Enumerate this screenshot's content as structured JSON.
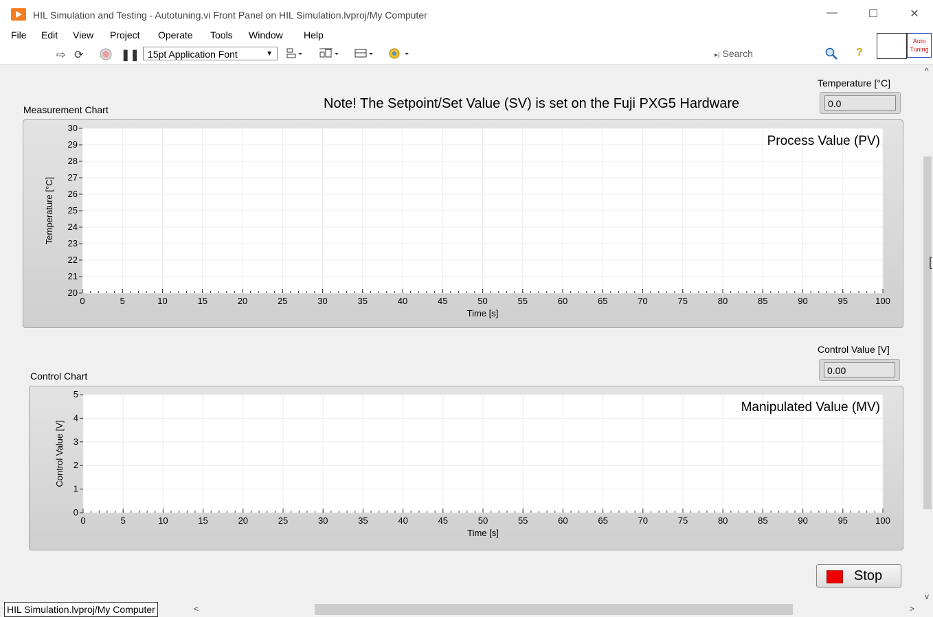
{
  "window": {
    "title": "HIL Simulation and Testing - Autotuning.vi Front Panel on HIL Simulation.lvproj/My Computer",
    "minimize": "—",
    "maximize": "☐",
    "close": "✕"
  },
  "menu": [
    "File",
    "Edit",
    "View",
    "Project",
    "Operate",
    "Tools",
    "Window",
    "Help"
  ],
  "toolbar": {
    "font_select": "15pt Application Font",
    "search_placeholder": "Search",
    "help_glyph": "?"
  },
  "vi_connector": {
    "line1": "Auto",
    "line2": "Tuning"
  },
  "note": "Note! The Setpoint/Set Value (SV) is set on the Fuji PXG5 Hardware",
  "temperature_indicator": {
    "label": "Temperature [°C]",
    "value": "0.0"
  },
  "control_indicator": {
    "label": "Control Value [V]",
    "value": "0.00"
  },
  "measurement_chart": {
    "label": "Measurement Chart",
    "plot_legend": "Process Value (PV)",
    "ylabel": "Temperature [°C]",
    "xlabel": "Time [s]"
  },
  "control_chart": {
    "label": "Control Chart",
    "plot_legend": "Manipulated Value (MV)",
    "ylabel": "Control Value [V]",
    "xlabel": "Time [s]"
  },
  "stop_button": "Stop",
  "status_bar": {
    "project_context": "HIL Simulation.lvproj/My Computer"
  },
  "chart_data": [
    {
      "type": "line",
      "title": "",
      "xlabel": "Time [s]",
      "ylabel": "Temperature [°C]",
      "xlim": [
        0,
        100
      ],
      "ylim": [
        20,
        30
      ],
      "xticks": [
        0,
        5,
        10,
        15,
        20,
        25,
        30,
        35,
        40,
        45,
        50,
        55,
        60,
        65,
        70,
        75,
        80,
        85,
        90,
        95,
        100
      ],
      "yticks": [
        20,
        21,
        22,
        23,
        24,
        25,
        26,
        27,
        28,
        29,
        30
      ],
      "series": [
        {
          "name": "Process Value (PV)",
          "values": []
        }
      ],
      "grid": true
    },
    {
      "type": "line",
      "title": "",
      "xlabel": "Time [s]",
      "ylabel": "Control Value [V]",
      "xlim": [
        0,
        100
      ],
      "ylim": [
        0,
        5
      ],
      "xticks": [
        0,
        5,
        10,
        15,
        20,
        25,
        30,
        35,
        40,
        45,
        50,
        55,
        60,
        65,
        70,
        75,
        80,
        85,
        90,
        95,
        100
      ],
      "yticks": [
        0,
        1,
        2,
        3,
        4,
        5
      ],
      "series": [
        {
          "name": "Manipulated Value (MV)",
          "values": []
        }
      ],
      "grid": true
    }
  ]
}
